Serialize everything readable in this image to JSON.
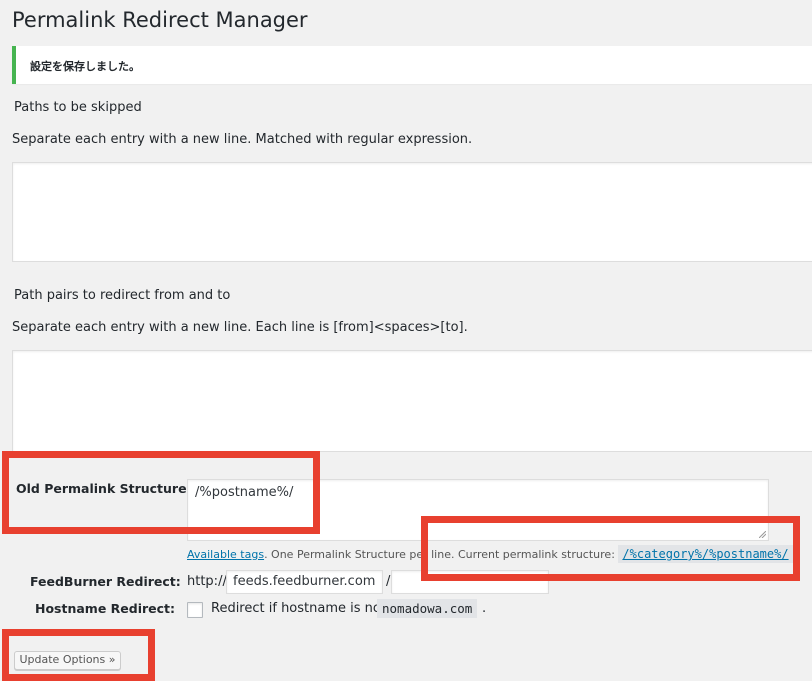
{
  "page": {
    "title": "Permalink Redirect Manager"
  },
  "notice": {
    "message": "設定を保存しました。"
  },
  "skip_paths": {
    "label": "Paths to be skipped",
    "description": "Separate each entry with a new line. Matched with regular expression.",
    "value": ""
  },
  "redirect_pairs": {
    "label": "Path pairs to redirect from and to",
    "description": "Separate each entry with a new line. Each line is [from]<spaces>[to].",
    "value": ""
  },
  "old_permalink": {
    "label": "Old Permalink Structures:",
    "value": "/%postname%/",
    "available_tags_link": "Available tags",
    "help_text": ". One Permalink Structure per line. Current permalink structure: ",
    "current_structure": "/%category%/%postname%/"
  },
  "feedburner": {
    "label": "FeedBurner Redirect:",
    "prefix": "http://",
    "host": "feeds.feedburner.com",
    "separator": "/",
    "path": ""
  },
  "hostname": {
    "label": "Hostname Redirect:",
    "checkbox_label": "Redirect if hostname is not",
    "hostname_value": "nomadowa.com",
    "suffix": ".",
    "checked": false
  },
  "actions": {
    "update_label": "Update Options »"
  },
  "colors": {
    "accent_red": "#e8402f",
    "success_green": "#46b450",
    "link_blue": "#0073aa"
  }
}
